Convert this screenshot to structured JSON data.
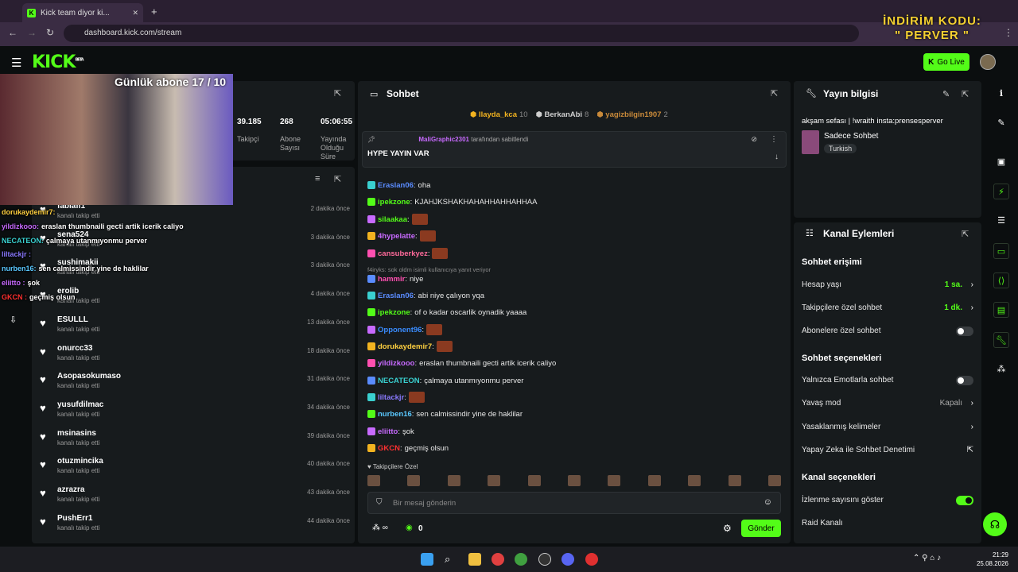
{
  "browser": {
    "tab_title": "Kick team diyor ki...",
    "url": "dashboard.kick.com/stream",
    "tab_close": "✕",
    "new_tab": "+"
  },
  "promo": {
    "line1": "İNDİRİM KODU:",
    "line2": "\" PERVER \""
  },
  "header": {
    "logo": "KICK",
    "beta": "BETA",
    "go_live": "Go Live"
  },
  "stream_overlay": {
    "title": "Günlük abone 17 / 10",
    "messages": [
      {
        "user": "dorukaydemir7:",
        "text": ""
      },
      {
        "user": "yildizkooo:",
        "text": "eraslan thumbnaili gecti artik icerik caliyo"
      },
      {
        "user": "NECATEON:",
        "text": "çalmaya utanmıyonmu perver"
      },
      {
        "user": "liltackjr :",
        "text": ""
      },
      {
        "user": "nurben16:",
        "text": "sen calmissindir yine de haklilar"
      },
      {
        "user": "eliitto :",
        "text": "şok"
      },
      {
        "user": "GKCN :",
        "text": "geçmiş olsun"
      }
    ]
  },
  "stats": [
    {
      "value": "39.185",
      "label": "Takipçi"
    },
    {
      "value": "268",
      "label": "Abone Sayısı"
    },
    {
      "value": "05:06:55",
      "label": "Yayında Olduğu Süre"
    }
  ],
  "followers": [
    {
      "name": "fablafl1",
      "sub": "kanalı takip etti",
      "time": "2 dakika önce"
    },
    {
      "name": "sena524",
      "sub": "kanalı takip etti",
      "time": "3 dakika önce"
    },
    {
      "name": "sushimakii",
      "sub": "kanalı takip etti",
      "time": "3 dakika önce"
    },
    {
      "name": "erolib",
      "sub": "kanalı takip etti",
      "time": "4 dakika önce"
    },
    {
      "name": "ESULLL",
      "sub": "kanalı takip etti",
      "time": "13 dakika önce"
    },
    {
      "name": "onurcc33",
      "sub": "kanalı takip etti",
      "time": "18 dakika önce"
    },
    {
      "name": "Asopasokumaso",
      "sub": "kanalı takip etti",
      "time": "31 dakika önce"
    },
    {
      "name": "yusufdilmac",
      "sub": "kanalı takip etti",
      "time": "34 dakika önce"
    },
    {
      "name": "msinasins",
      "sub": "kanalı takip etti",
      "time": "39 dakika önce"
    },
    {
      "name": "otuzmincika",
      "sub": "kanalı takip etti",
      "time": "40 dakika önce"
    },
    {
      "name": "azrazra",
      "sub": "kanalı takip etti",
      "time": "43 dakika önce"
    },
    {
      "name": "PushErr1",
      "sub": "kanalı takip etti",
      "time": "44 dakika önce"
    }
  ],
  "chat": {
    "title": "Sohbet",
    "top_gifters": [
      {
        "name": "Ilayda_kca",
        "count": "10",
        "color": "#f2b320"
      },
      {
        "name": "BerkanAbi",
        "count": "8",
        "color": "#cfcfcf"
      },
      {
        "name": "yagizbilgin1907",
        "count": "2",
        "color": "#c98a3a"
      }
    ],
    "pinned": {
      "by_user": "MaliGraphic2301",
      "by_text": "tarafından sabitlendi",
      "message": "HYPE YAYIN VAR"
    },
    "messages": [
      {
        "user": "Eraslan06",
        "color": "#5a8cff",
        "text": "oha",
        "emote": false
      },
      {
        "user": "ipekzone",
        "color": "#53fc18",
        "text": "KJAHJKSHAKHAHAHHAHHAHHAA",
        "emote": false
      },
      {
        "user": "silaakaa",
        "color": "#53fc18",
        "text": "",
        "emote": true
      },
      {
        "user": "4hypelatte",
        "color": "#c86aff",
        "text": "",
        "emote": true
      },
      {
        "user": "cansuberkyez",
        "color": "#ff6a9a",
        "text": "",
        "emote": true
      },
      {
        "user": "hammir",
        "color": "#ff4fb0",
        "text": "niye",
        "emote": false,
        "reply": "f4iryks: sok oldm isimli kullanıcıya yanıt veriyor"
      },
      {
        "user": "Eraslan06",
        "color": "#5a8cff",
        "text": "abi niye çalıyon yqa",
        "emote": false
      },
      {
        "user": "ipekzone",
        "color": "#53fc18",
        "text": "of o kadar oscarlik oynadik yaaaa",
        "emote": false
      },
      {
        "user": "Opponent96",
        "color": "#3a8cff",
        "text": "",
        "emote": true
      },
      {
        "user": "dorukaydemir7",
        "color": "#ffd040",
        "text": "",
        "emote": true
      },
      {
        "user": "yildizkooo",
        "color": "#c86aff",
        "text": "eraslan thumbnaili gecti artik icerik caliyo",
        "emote": false
      },
      {
        "user": "NECATEON",
        "color": "#3ad0d0",
        "text": "çalmaya utanmıyonmu perver",
        "emote": false
      },
      {
        "user": "liltackjr",
        "color": "#8a7aff",
        "text": "",
        "emote": true
      },
      {
        "user": "nurben16",
        "color": "#5ac8ff",
        "text": "sen calmissindir yine de haklilar",
        "emote": false
      },
      {
        "user": "eliitto",
        "color": "#c86aff",
        "text": "şok",
        "emote": false
      },
      {
        "user": "GKCN",
        "color": "#ff3030",
        "text": "geçmiş olsun",
        "emote": false
      }
    ],
    "followers_only": "Takipçilere Özel",
    "input_placeholder": "Bir mesaj gönderin",
    "viewer_count": "0",
    "send": "Gönder"
  },
  "stream_info": {
    "title": "Yayın bilgisi",
    "stream_title": "akşam sefası | !wraith insta:prensesperver",
    "category": "Sadece Sohbet",
    "tag": "Turkish"
  },
  "channel_actions": {
    "title": "Kanal Eylemleri",
    "chat_access": "Sohbet erişimi",
    "account_age": {
      "label": "Hesap yaşı",
      "value": "1 sa."
    },
    "followers_chat": {
      "label": "Takipçilere özel sohbet",
      "value": "1 dk."
    },
    "subs_chat": {
      "label": "Abonelere özel sohbet"
    },
    "chat_options": "Sohbet seçenekleri",
    "emote_only": {
      "label": "Yalnızca Emotlarla sohbet"
    },
    "slow_mode": {
      "label": "Yavaş mod",
      "value": "Kapalı"
    },
    "banned_words": {
      "label": "Yasaklanmış kelimeler"
    },
    "ai_moderation": {
      "label": "Yapay Zeka ile Sohbet Denetimi"
    },
    "channel_options": "Kanal seçenekleri",
    "show_viewers": {
      "label": "İzlenme sayısını göster"
    },
    "raid": {
      "label": "Raid Kanalı"
    }
  },
  "taskbar": {
    "time": "21:29",
    "date": "25.08.2026"
  }
}
